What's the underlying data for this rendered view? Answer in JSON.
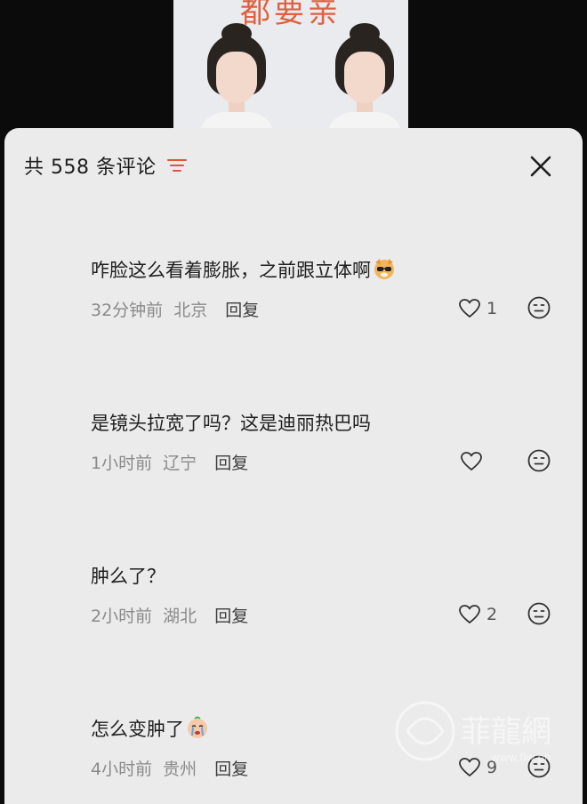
{
  "video": {
    "caption": "都要亲"
  },
  "header": {
    "comment_count_label": "共 558 条评论"
  },
  "comments": [
    {
      "text": "咋脸这么看着膨胀，之前跟立体啊",
      "time": "32分钟前",
      "location": "北京",
      "reply_label": "回复",
      "likes": "1",
      "emoji": "dog-sunglasses-emoji"
    },
    {
      "text": "是镜头拉宽了吗？这是迪丽热巴吗",
      "time": "1小时前",
      "location": "辽宁",
      "reply_label": "回复",
      "likes": ""
    },
    {
      "text": "肿么了？",
      "time": "2小时前",
      "location": "湖北",
      "reply_label": "回复",
      "likes": "2"
    },
    {
      "text": "怎么变肿了",
      "time": "4小时前",
      "location": "贵州",
      "reply_label": "回复",
      "likes": "9",
      "emoji": "crying-face-emoji"
    }
  ],
  "icons": {
    "sort": "sort-filter-icon",
    "close": "close-icon",
    "like": "heart-outline-icon",
    "emoji_react": "smiley-face-icon"
  },
  "colors": {
    "accent": "#e0533c",
    "sheet_bg": "#ebebeb",
    "text": "#1f1f1f",
    "meta": "#8a8a8a"
  },
  "watermark": {
    "text": "菲龍網",
    "url_text": "www.flw.ph"
  }
}
